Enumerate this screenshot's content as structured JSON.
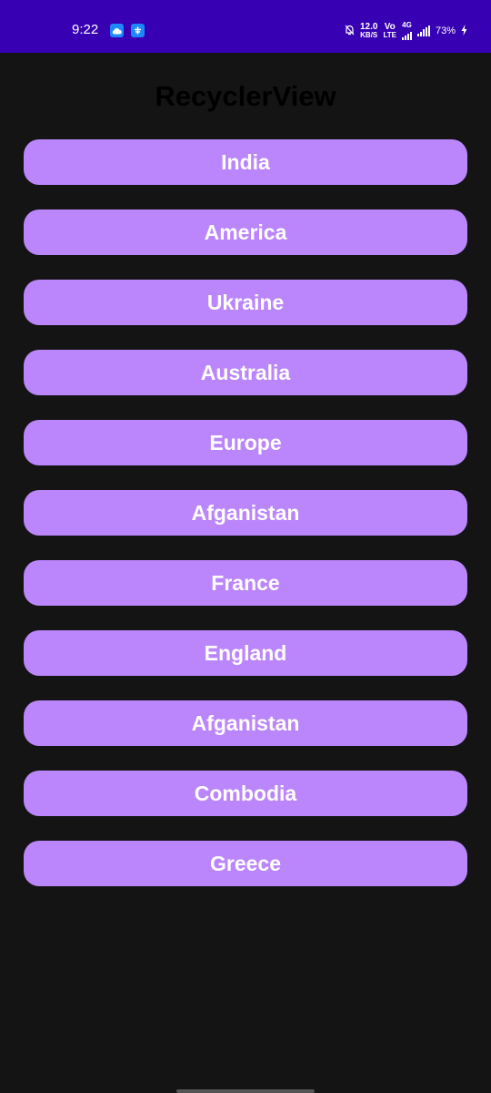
{
  "status_bar": {
    "time": "9:22",
    "net_speed_value": "12.0",
    "net_speed_unit": "KB/S",
    "volte_top": "Vo",
    "volte_bottom": "LTE",
    "network_type": "4G",
    "battery": "73%",
    "icons": [
      "cloud-icon",
      "app-notification-icon",
      "mute-bell-icon",
      "signal-icon",
      "charging-icon"
    ]
  },
  "header": {
    "title": "RecyclerView"
  },
  "countries": [
    {
      "label": "India"
    },
    {
      "label": "America"
    },
    {
      "label": "Ukraine"
    },
    {
      "label": "Australia"
    },
    {
      "label": "Europe"
    },
    {
      "label": "Afganistan"
    },
    {
      "label": "France"
    },
    {
      "label": "England"
    },
    {
      "label": "Afganistan"
    },
    {
      "label": "Combodia"
    },
    {
      "label": "Greece"
    }
  ],
  "colors": {
    "status_bar": "#3700b3",
    "background": "#141414",
    "button": "#bb86fc",
    "button_text": "#ffffff",
    "title": "#000000"
  }
}
